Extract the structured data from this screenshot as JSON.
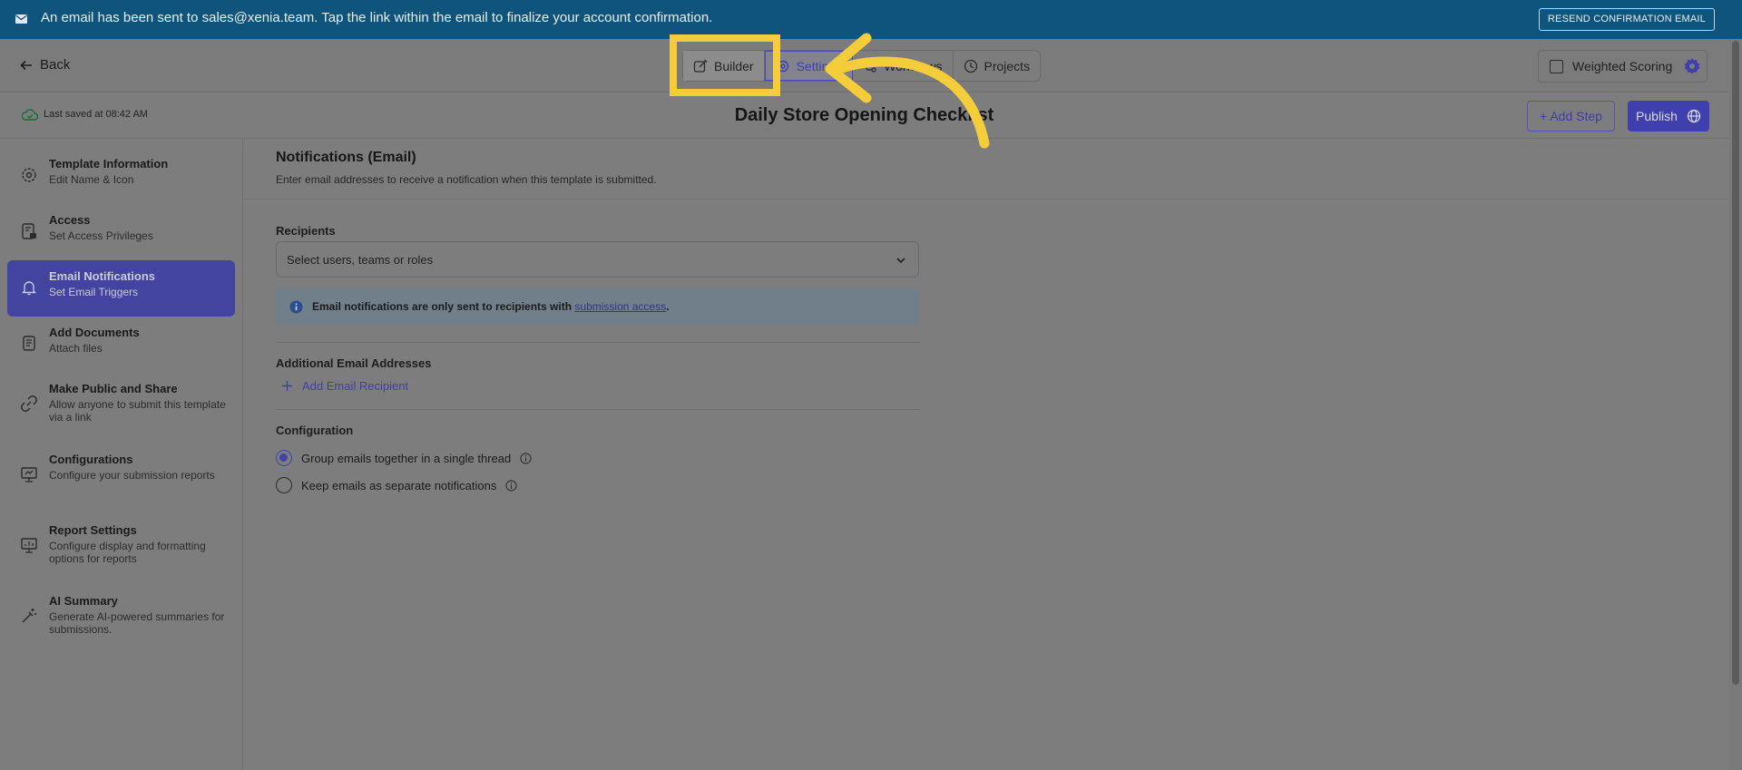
{
  "banner": {
    "message": "An email has been sent to sales@xenia.team. Tap the link within the email to finalize your account confirmation.",
    "resend_label": "RESEND CONFIRMATION EMAIL"
  },
  "toolbar": {
    "back_label": "Back",
    "tabs": [
      {
        "label": "Builder"
      },
      {
        "label": "Settings"
      },
      {
        "label": "Workflows"
      },
      {
        "label": "Projects"
      }
    ],
    "weighted_scoring_label": "Weighted Scoring"
  },
  "title_row": {
    "last_saved": "Last saved at 08:42 AM",
    "title": "Daily Store Opening Checklist",
    "add_step_label": "+ Add Step",
    "publish_label": "Publish"
  },
  "sidebar": {
    "items": [
      {
        "title": "Template Information",
        "subtitle": "Edit Name & Icon"
      },
      {
        "title": "Access",
        "subtitle": "Set Access Privileges"
      },
      {
        "title": "Email Notifications",
        "subtitle": "Set Email Triggers"
      },
      {
        "title": "Add Documents",
        "subtitle": "Attach files"
      },
      {
        "title": "Make Public and Share",
        "subtitle": "Allow anyone to submit this template via a link"
      },
      {
        "title": "Configurations",
        "subtitle": "Configure your submission reports"
      },
      {
        "title": "Report Settings",
        "subtitle": "Configure display and formatting options for reports"
      },
      {
        "title": "AI Summary",
        "subtitle": "Generate AI-powered summaries for submissions."
      }
    ]
  },
  "main": {
    "heading": "Notifications (Email)",
    "subheading": "Enter email addresses to receive a notification when this template is submitted.",
    "recipients_label": "Recipients",
    "recipients_placeholder": "Select users, teams or roles",
    "info_text": "Email notifications are only sent to recipients with ",
    "info_link": "submission access",
    "info_end": ".",
    "additional_label": "Additional Email Addresses",
    "add_recipient_label": "Add Email Recipient",
    "configuration_label": "Configuration",
    "options": [
      {
        "label": "Group emails together in a single thread",
        "selected": true
      },
      {
        "label": "Keep emails as separate notifications",
        "selected": false
      }
    ]
  },
  "colors": {
    "accent": "#4244a8",
    "highlight": "#f5cd3a",
    "banner": "#0f547c"
  }
}
